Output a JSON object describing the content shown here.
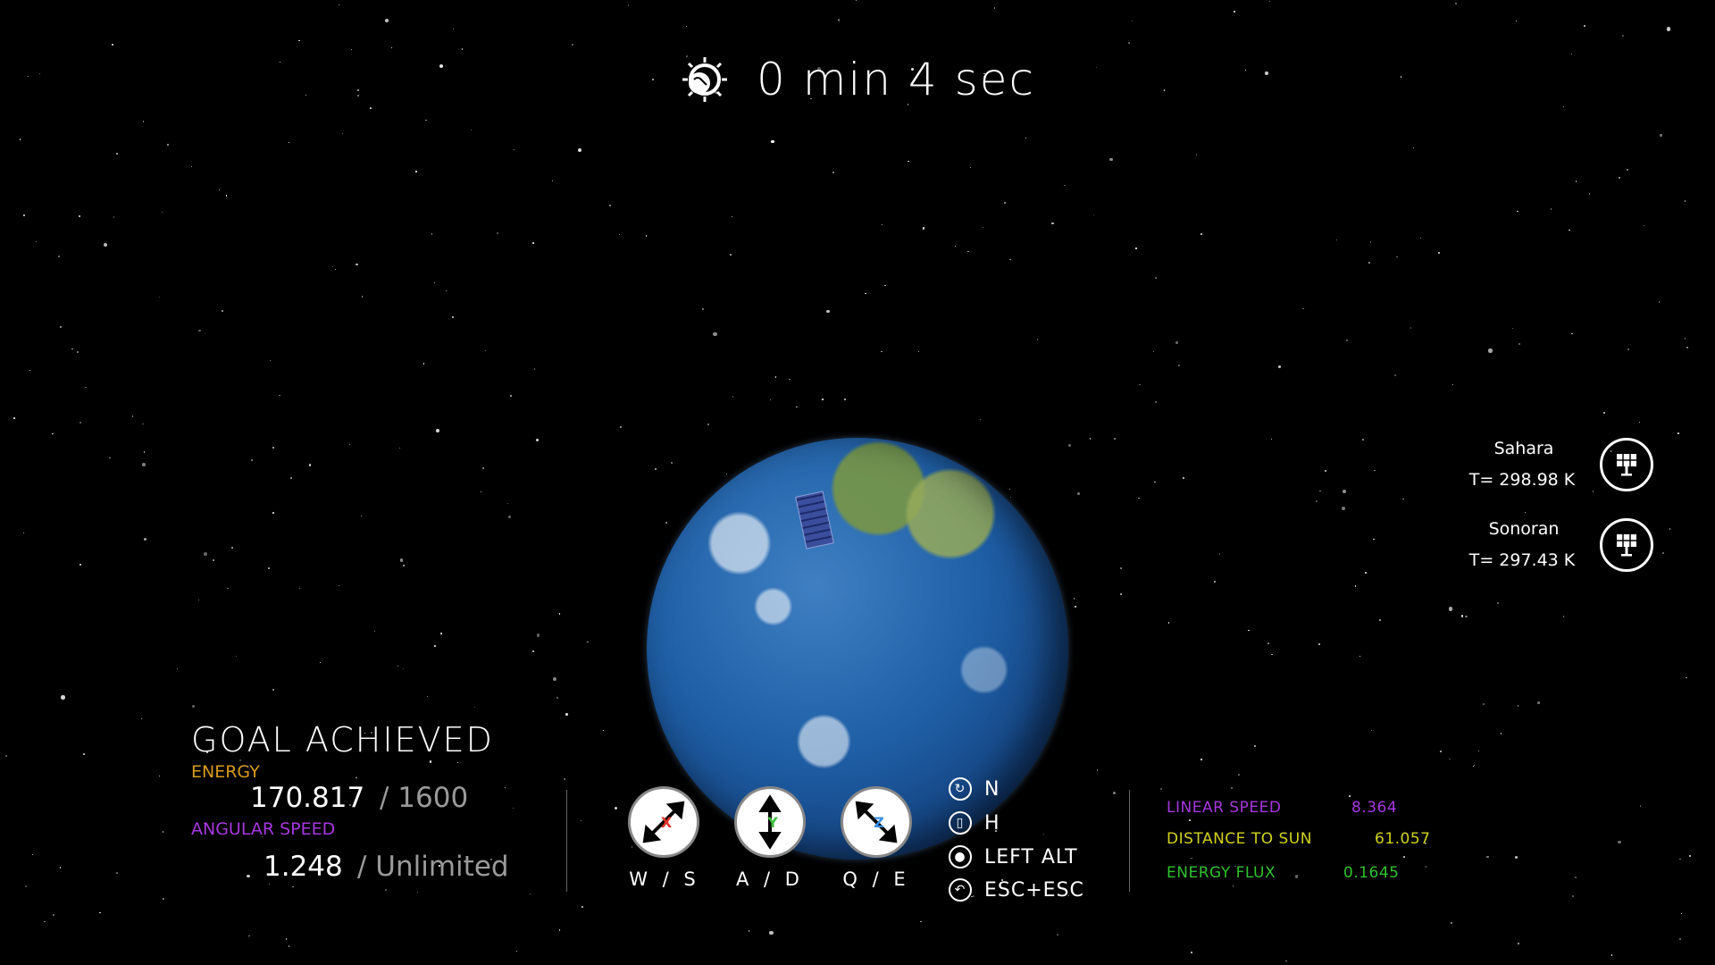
{
  "timer": {
    "text": "0 min 4 sec",
    "icon": "sun-earth-icon"
  },
  "status": {
    "goal": "GOAL ACHIEVED",
    "energy_label": "ENERGY",
    "energy_value": "170.817",
    "energy_max": "/ 1600",
    "angular_label": "ANGULAR SPEED",
    "angular_value": "1.248",
    "angular_max": "/ Unlimited"
  },
  "controls": [
    {
      "label": "W / S",
      "axis": "X",
      "axis_color": "#e0302a",
      "icon": "rotate-x-icon"
    },
    {
      "label": "A / D",
      "axis": "Y",
      "axis_color": "#3fbf3f",
      "icon": "rotate-y-icon"
    },
    {
      "label": "Q / E",
      "axis": "Z",
      "axis_color": "#3a8fe0",
      "icon": "rotate-z-icon"
    }
  ],
  "keys": [
    {
      "label": "N",
      "icon": "cycle-icon"
    },
    {
      "label": "H",
      "icon": "book-icon"
    },
    {
      "label": "LEFT ALT",
      "icon": "target-icon"
    },
    {
      "label": "ESC+ESC",
      "icon": "back-icon"
    }
  ],
  "metrics": [
    {
      "label": "LINEAR SPEED",
      "value": "8.364",
      "color": "#a637e0"
    },
    {
      "label": "DISTANCE TO SUN",
      "value": "61.057",
      "color": "#d0d21a"
    },
    {
      "label": "ENERGY FLUX",
      "value": "0.1645",
      "color": "#2fc22f"
    }
  ],
  "deserts": [
    {
      "name": "Sahara",
      "temp": "T= 298.98 K",
      "icon": "solar-panel-icon"
    },
    {
      "name": "Sonoran",
      "temp": "T= 297.43 K",
      "icon": "solar-panel-icon"
    }
  ]
}
